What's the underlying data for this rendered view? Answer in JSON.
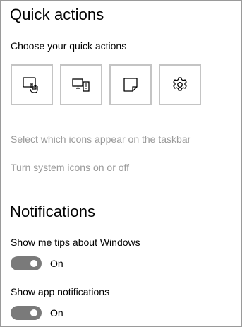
{
  "quick_actions": {
    "title": "Quick actions",
    "subtitle": "Choose your quick actions",
    "tiles": [
      {
        "icon": "tablet-mode-icon"
      },
      {
        "icon": "project-display-icon"
      },
      {
        "icon": "note-icon"
      },
      {
        "icon": "settings-gear-icon"
      }
    ],
    "links": {
      "taskbar_icons": "Select which icons appear on the taskbar",
      "system_icons": "Turn system icons on or off"
    }
  },
  "notifications": {
    "title": "Notifications",
    "settings": [
      {
        "label": "Show me tips about Windows",
        "state": "On",
        "enabled": true
      },
      {
        "label": "Show app notifications",
        "state": "On",
        "enabled": true
      }
    ]
  },
  "colors": {
    "toggle_on_track": "#7a7a7a",
    "link_gray": "#9a9a9a",
    "tile_border": "#c4c4c4"
  }
}
